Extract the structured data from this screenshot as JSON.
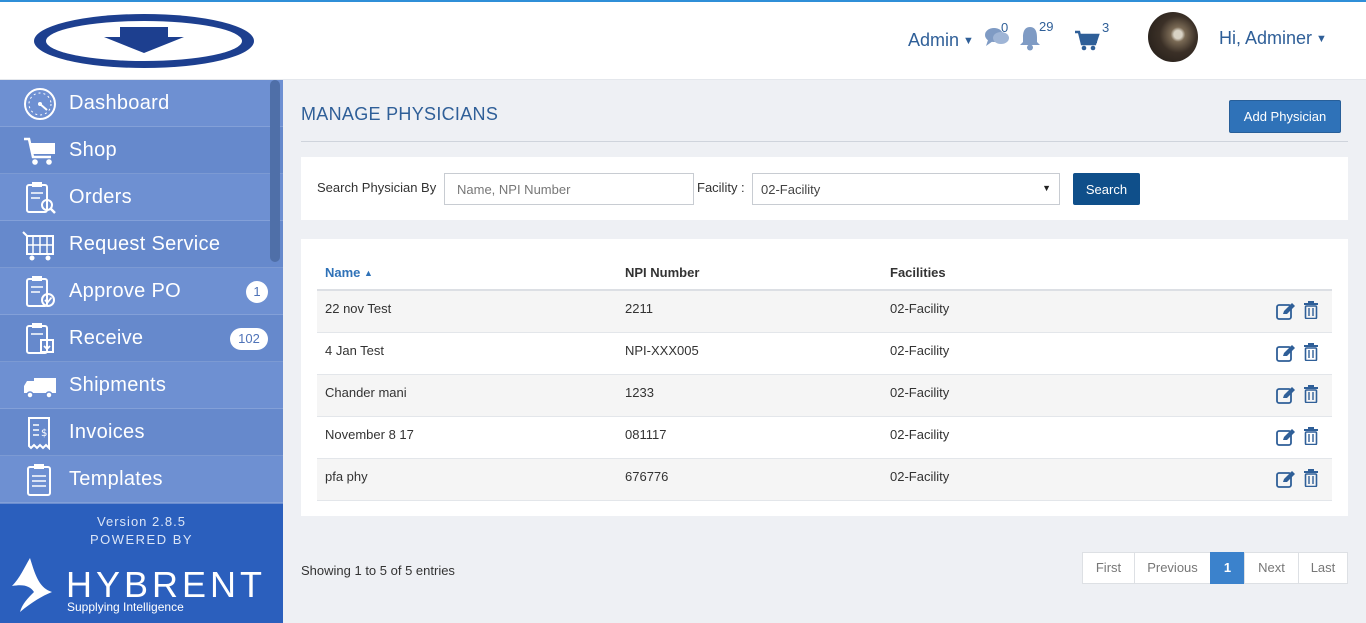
{
  "header": {
    "admin_menu": "Admin",
    "messages_count": "0",
    "notifications_count": "29",
    "cart_count": "3",
    "user_greeting": "Hi, Adminer"
  },
  "sidebar": {
    "items": [
      {
        "label": "Dashboard",
        "icon": "dashboard-icon"
      },
      {
        "label": "Shop",
        "icon": "cart-icon"
      },
      {
        "label": "Orders",
        "icon": "orders-icon"
      },
      {
        "label": "Request Service",
        "icon": "request-service-icon"
      },
      {
        "label": "Approve PO",
        "icon": "approve-po-icon",
        "badge": "1"
      },
      {
        "label": "Receive",
        "icon": "receive-icon",
        "badge": "102"
      },
      {
        "label": "Shipments",
        "icon": "truck-icon"
      },
      {
        "label": "Invoices",
        "icon": "invoice-icon"
      },
      {
        "label": "Templates",
        "icon": "templates-icon"
      }
    ],
    "version": "Version 2.8.5",
    "powered_by": "POWERED BY",
    "brand": "HYBRENT",
    "tagline": "Supplying Intelligence"
  },
  "main": {
    "title": "MANAGE PHYSICIANS",
    "add_button": "Add Physician",
    "search": {
      "label": "Search Physician By",
      "placeholder": "Name, NPI Number",
      "facility_label": "Facility :",
      "facility_value": "02-Facility",
      "button": "Search"
    },
    "table": {
      "headers": {
        "name": "Name",
        "npi": "NPI Number",
        "facilities": "Facilities"
      },
      "rows": [
        {
          "name": "22 nov Test",
          "npi": "2211",
          "facility": "02-Facility"
        },
        {
          "name": "4 Jan Test",
          "npi": "NPI-XXX005",
          "facility": "02-Facility"
        },
        {
          "name": "Chander mani",
          "npi": "1233",
          "facility": "02-Facility"
        },
        {
          "name": "November 8 17",
          "npi": "081117",
          "facility": "02-Facility"
        },
        {
          "name": "pfa phy",
          "npi": "676776",
          "facility": "02-Facility"
        }
      ]
    },
    "showing": "Showing 1 to 5 of 5 entries",
    "pagination": {
      "first": "First",
      "previous": "Previous",
      "current": "1",
      "next": "Next",
      "last": "Last"
    }
  },
  "colors": {
    "accent": "#2f72b8",
    "sidebar": "#6b8dd0",
    "sidebar_footer": "#2b5fbd",
    "search_button": "#0f4f8a"
  }
}
